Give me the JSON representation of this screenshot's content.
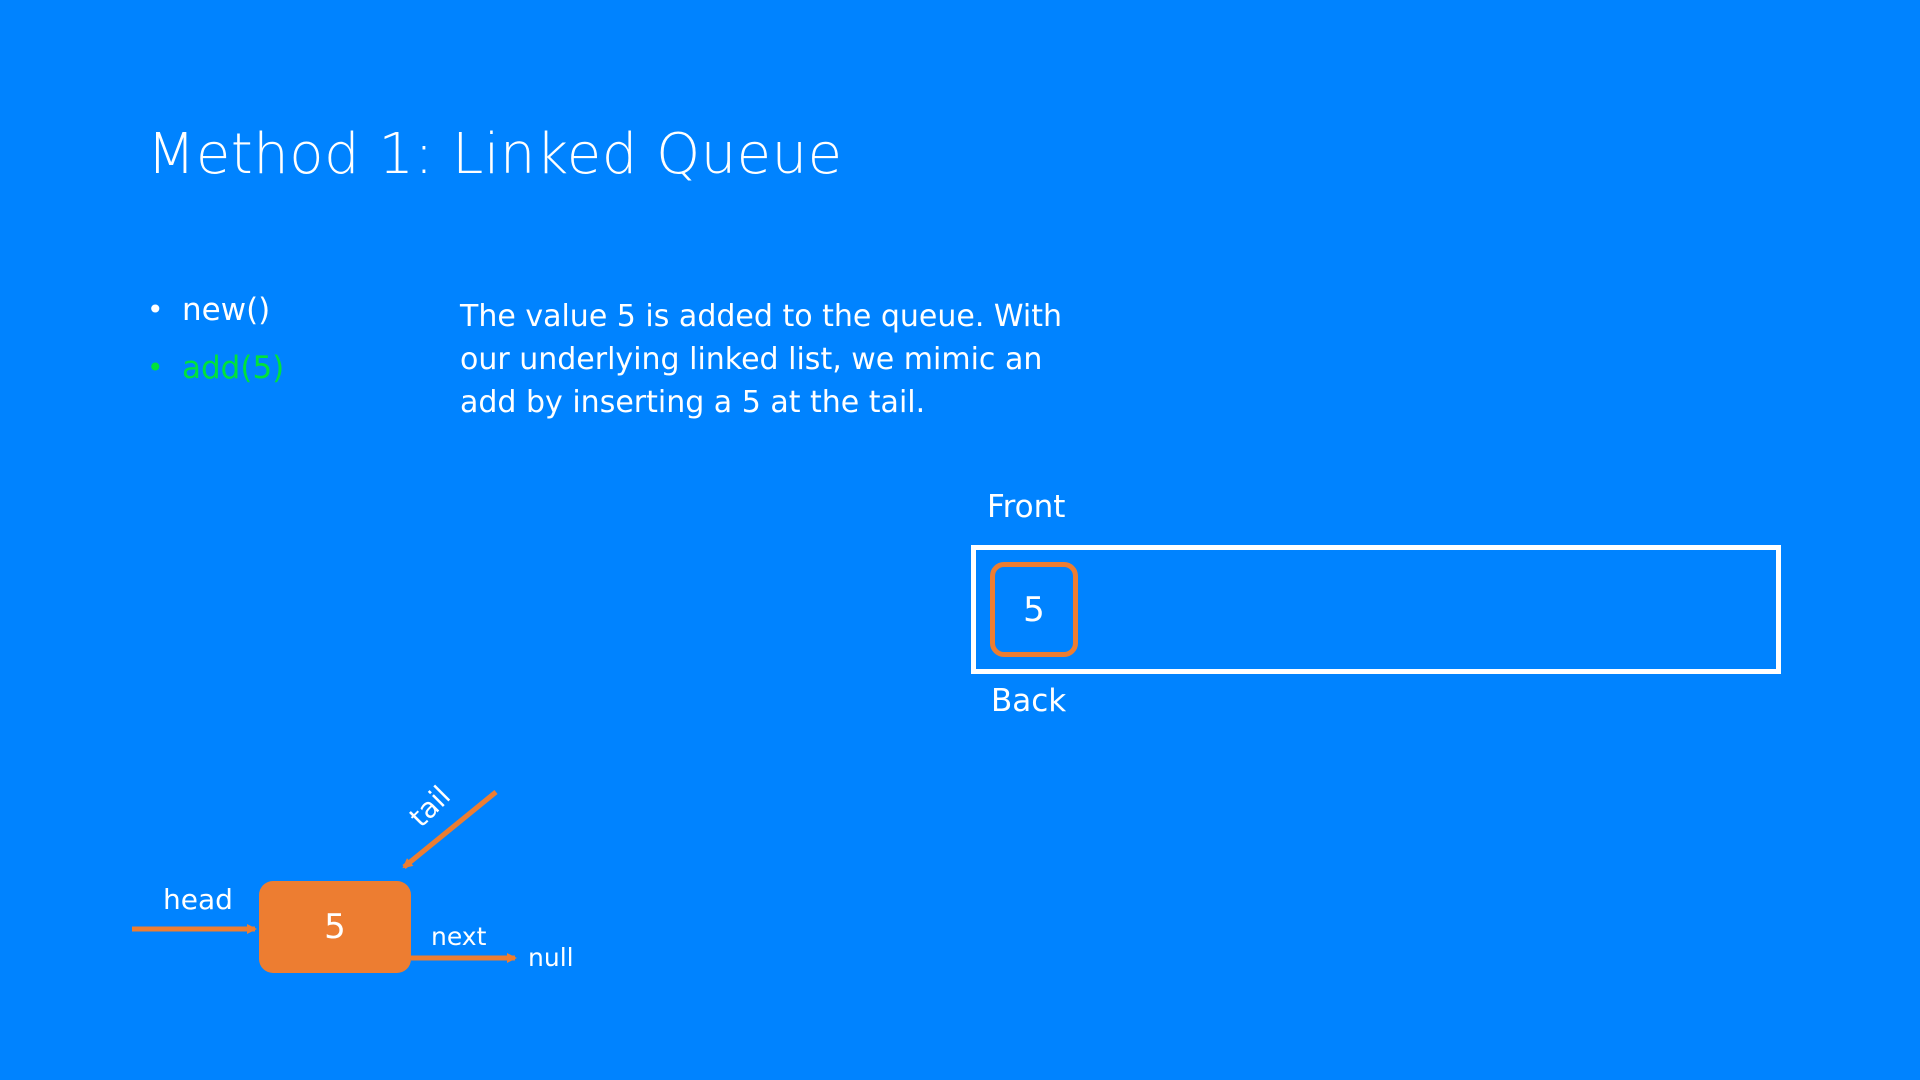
{
  "slide": {
    "title": "Method 1: Linked Queue",
    "operations": [
      {
        "label": "new()",
        "active": false
      },
      {
        "label": "add(5)",
        "active": true
      }
    ],
    "description": "The value 5 is added to the queue. With our underlying linked list, we mimic an add by inserting a 5 at the tail."
  },
  "queue": {
    "front_label": "Front",
    "back_label": "Back",
    "items": [
      "5"
    ]
  },
  "linked_list": {
    "node_value": "5",
    "head_label": "head",
    "tail_label": "tail",
    "next_label": "next",
    "null_label": "null"
  },
  "colors": {
    "background": "#0083FF",
    "accent": "#ED7D31",
    "active_text": "#00E33A",
    "text": "#FFFFFF"
  }
}
